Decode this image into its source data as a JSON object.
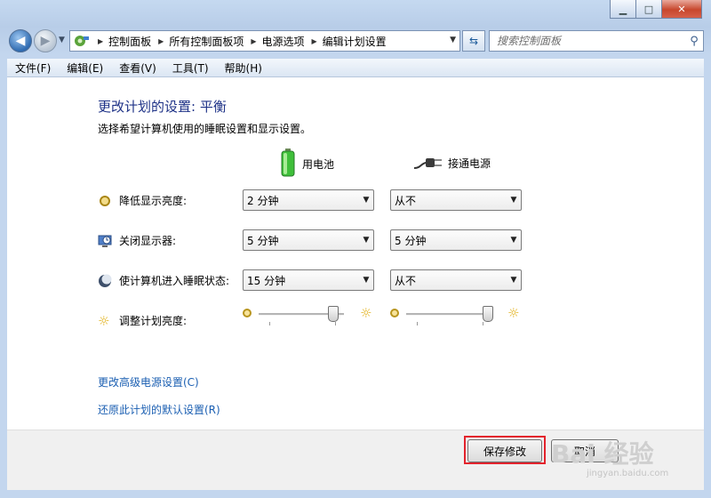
{
  "window": {
    "minimize_glyph": "▁",
    "maximize_glyph": "□",
    "close_glyph": "✕"
  },
  "nav": {
    "breadcrumb": [
      "控制面板",
      "所有控制面板项",
      "电源选项",
      "编辑计划设置"
    ],
    "search_placeholder": "搜索控制面板"
  },
  "menu": [
    "文件(F)",
    "编辑(E)",
    "查看(V)",
    "工具(T)",
    "帮助(H)"
  ],
  "main": {
    "heading": "更改计划的设置: 平衡",
    "subtitle": "选择希望计算机使用的睡眠设置和显示设置。",
    "col_battery": "用电池",
    "col_plugged": "接通电源",
    "rows": [
      {
        "label": "降低显示亮度:",
        "icon": "dim-display-icon",
        "battery": "2 分钟",
        "plugged": "从不"
      },
      {
        "label": "关闭显示器:",
        "icon": "display-off-icon",
        "battery": "5 分钟",
        "plugged": "5 分钟"
      },
      {
        "label": "使计算机进入睡眠状态:",
        "icon": "sleep-moon-icon",
        "battery": "15 分钟",
        "plugged": "从不"
      }
    ],
    "brightness_label": "调整计划亮度:",
    "brightness_battery": 0.86,
    "brightness_plugged": 0.95,
    "link_advanced": "更改高级电源设置(C)",
    "link_restore": "还原此计划的默认设置(R)"
  },
  "buttons": {
    "save": "保存修改",
    "cancel": "取消"
  },
  "watermark": {
    "text": "Bai 经验",
    "url": "jingyan.baidu.com"
  },
  "colors": {
    "heading": "#1e3287",
    "link": "#1b5fb2",
    "highlight": "#e3232c"
  }
}
